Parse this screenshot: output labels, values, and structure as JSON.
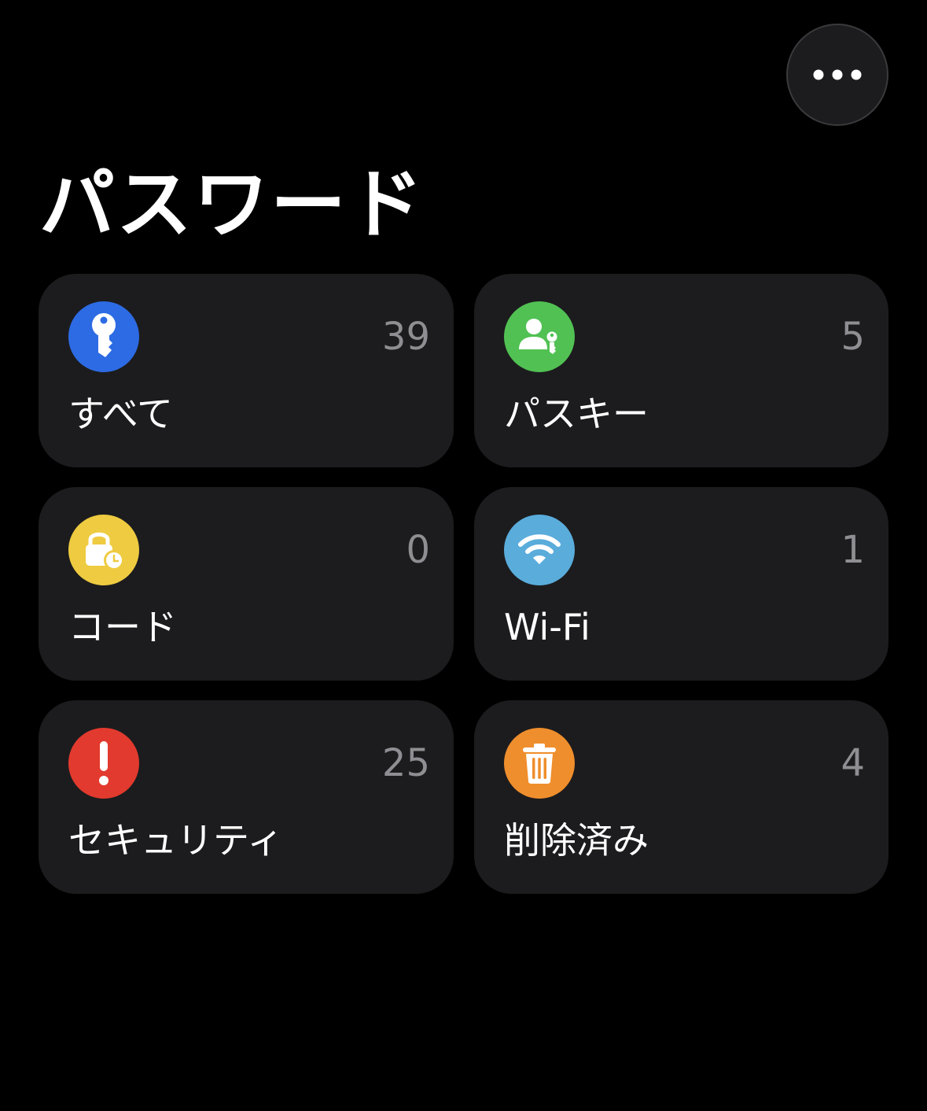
{
  "header": {
    "title": "パスワード",
    "more_button_icon": "ellipsis-icon"
  },
  "tiles": [
    {
      "label": "すべて",
      "count": "39",
      "icon": "key-icon",
      "color": "#2d6be4"
    },
    {
      "label": "パスキー",
      "count": "5",
      "icon": "person-key-icon",
      "color": "#51c153"
    },
    {
      "label": "コード",
      "count": "0",
      "icon": "lock-clock-icon",
      "color": "#eecb40"
    },
    {
      "label": "Wi-Fi",
      "count": "1",
      "icon": "wifi-icon",
      "color": "#5aacdb"
    },
    {
      "label": "セキュリティ",
      "count": "25",
      "icon": "exclamation-icon",
      "color": "#e23a2e"
    },
    {
      "label": "削除済み",
      "count": "4",
      "icon": "trash-icon",
      "color": "#ef8e2c"
    }
  ]
}
